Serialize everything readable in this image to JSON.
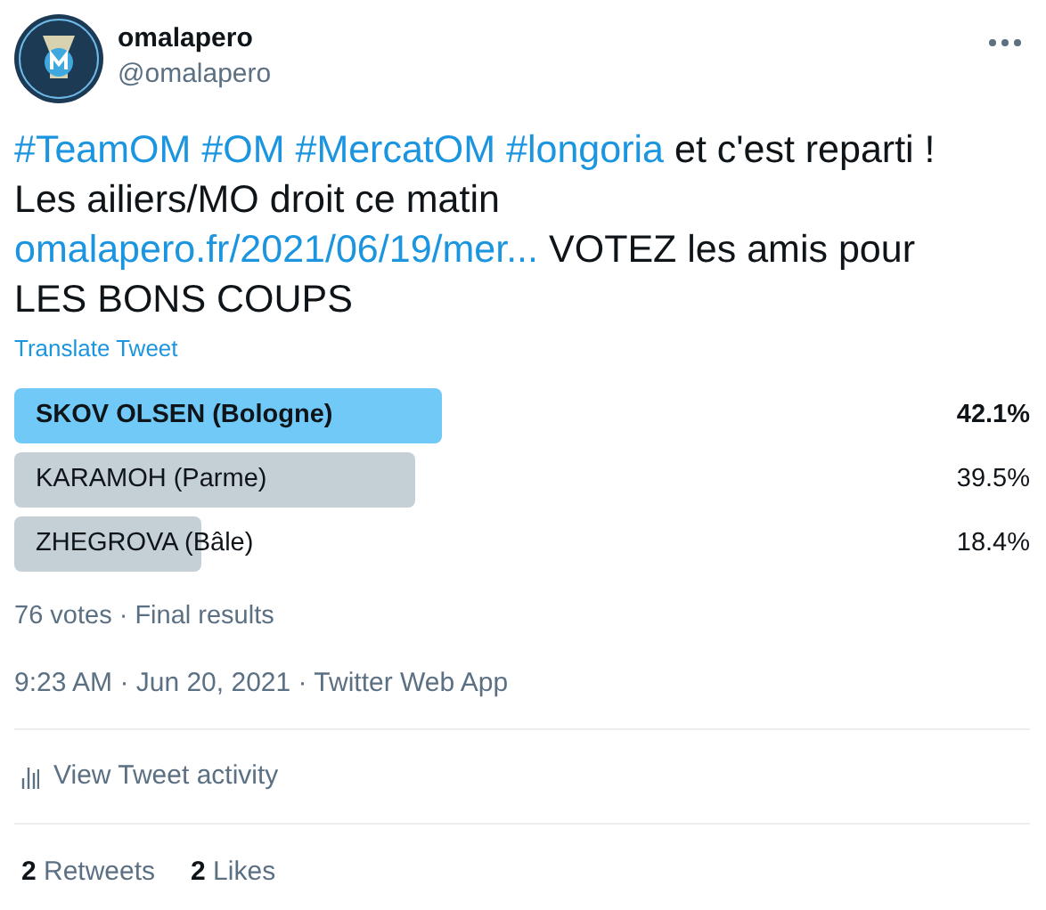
{
  "author": {
    "name": "omalapero",
    "handle": "@omalapero"
  },
  "body": [
    [
      {
        "kind": "hashtag",
        "text": "#TeamOM"
      },
      {
        "kind": "hashtag",
        "text": "#OM"
      },
      {
        "kind": "hashtag",
        "text": "#MercatOM"
      },
      {
        "kind": "hashtag",
        "text": "#longoria"
      },
      {
        "kind": "text",
        "text": "et c'est reparti !"
      }
    ],
    [
      {
        "kind": "text",
        "text": "Les ailiers/MO droit ce matin"
      }
    ],
    [
      {
        "kind": "link",
        "text": "omalapero.fr/2021/06/19/mer..."
      },
      {
        "kind": "text",
        "text": "VOTEZ les amis pour"
      }
    ],
    [
      {
        "kind": "text",
        "text": "LES BONS COUPS"
      }
    ]
  ],
  "translate": "Translate Tweet",
  "poll": {
    "options": [
      {
        "label": "SKOV OLSEN (Bologne)",
        "percent": "42.1%",
        "winner": true
      },
      {
        "label": "KARAMOH (Parme)",
        "percent": "39.5%",
        "winner": false
      },
      {
        "label": "ZHEGROVA (Bâle)",
        "percent": "18.4%",
        "winner": false
      }
    ],
    "summary": "76 votes · Final results"
  },
  "timestamp": "9:23 AM · Jun 20, 2021 · Twitter Web App",
  "activity": "View Tweet activity",
  "stats": [
    {
      "count": "2",
      "label": "Retweets"
    },
    {
      "count": "2",
      "label": "Likes"
    }
  ]
}
